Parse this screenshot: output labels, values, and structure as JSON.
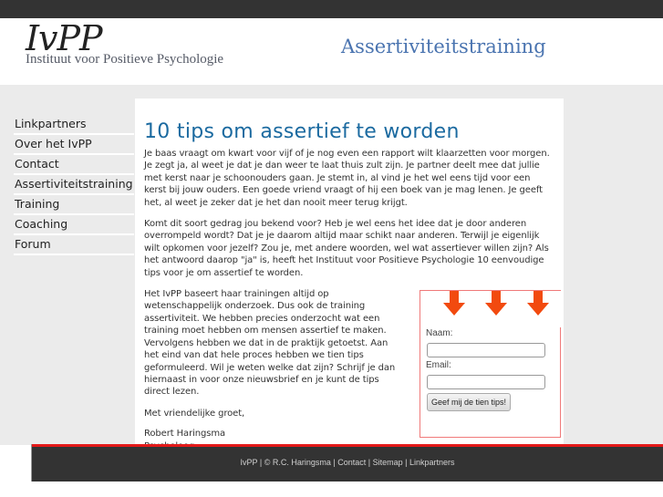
{
  "header": {
    "logo_main": "IvPP",
    "logo_sub": "Instituut voor Positieve Psychologie",
    "site_title": "Assertiviteitstraining"
  },
  "sidebar": {
    "items": [
      {
        "label": "Linkpartners"
      },
      {
        "label": "Over het IvPP"
      },
      {
        "label": "Contact"
      },
      {
        "label": "Assertiviteitstraining"
      },
      {
        "label": "Training"
      },
      {
        "label": "Coaching"
      },
      {
        "label": "Forum"
      }
    ]
  },
  "article": {
    "title": "10 tips om assertief te worden",
    "paragraphs": [
      "Je baas vraagt om kwart voor vijf of je nog even een rapport wilt klaarzetten voor morgen. Je zegt ja, al weet je dat je dan weer te laat thuis zult zijn. Je partner deelt mee dat jullie met kerst naar je schoonouders gaan. Je stemt in, al vind je het wel eens tijd voor een kerst bij jouw ouders. Een goede vriend vraagt of hij een boek van je mag lenen. Je geeft het, al weet je zeker dat je het dan nooit meer terug krijgt.",
      "Komt dit soort gedrag jou bekend voor? Heb je wel eens het idee dat je door anderen overrompeld wordt? Dat je je daarom altijd maar schikt naar anderen. Terwijl je eigenlijk wilt opkomen voor jezelf? Zou je, met andere woorden, wel wat assertiever willen zijn? Als het antwoord daarop \"ja\" is, heeft het Instituut voor Positieve Psychologie 10 eenvoudige tips voor je om assertief te worden.",
      "Het IvPP baseert haar trainingen altijd op wetenschappelijk onderzoek. Dus ook de training assertiviteit. We hebben precies onderzocht wat een training moet hebben om mensen assertief te maken. Vervolgens hebben we dat in de praktijk getoetst. Aan het eind van dat hele proces hebben we tien tips geformuleerd. Wil je weten welke dat zijn? Schrijf je dan hiernaast in voor onze nieuwsbrief en je kunt de tips direct lezen.",
      "Met vriendelijke groet,"
    ],
    "signature_name": "Robert Haringsma",
    "signature_role": "Psycholoog"
  },
  "signup_form": {
    "name_label": "Naam:",
    "name_value": "",
    "email_label": "Email:",
    "email_value": "",
    "submit_label": "Geef mij de tien tips!",
    "arrow_icon": "arrow-down-icon",
    "arrow_color": "#f24a0f",
    "border_color": "#f07a7a"
  },
  "footer": {
    "links": [
      "IvPP",
      "© R.C. Haringsma",
      "Contact",
      "Sitemap",
      "Linkpartners"
    ],
    "separator": " | ",
    "accent_color": "#e31919"
  }
}
